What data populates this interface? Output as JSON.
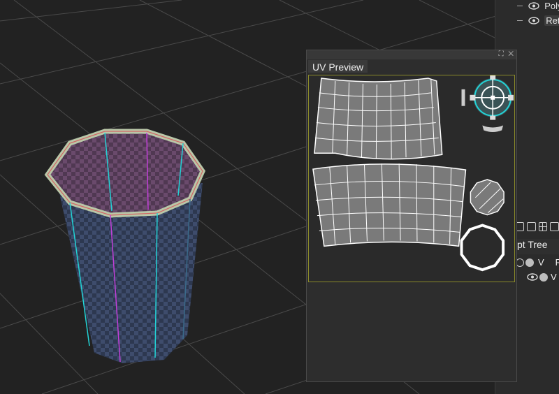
{
  "scene": {
    "name": "3d-viewport"
  },
  "layers": [
    {
      "label": "Poly",
      "selected": false
    },
    {
      "label": "Reto",
      "selected": true
    }
  ],
  "uv_preview": {
    "tab_label": "UV  Preview",
    "controls": "⛶ ✕"
  },
  "tree_panel": {
    "tab_label": "pt  Tree",
    "rows": [
      {
        "label": "V",
        "suffix": "Ro"
      },
      {
        "label": "V",
        "suffix": ""
      }
    ]
  },
  "colors": {
    "uv_shell_fill": "#7a7a7a",
    "uv_line": "#ffffff",
    "canvas_border": "#8a8a2a",
    "seam_cyan": "#22d3d6",
    "seam_magenta": "#c23fd9"
  }
}
